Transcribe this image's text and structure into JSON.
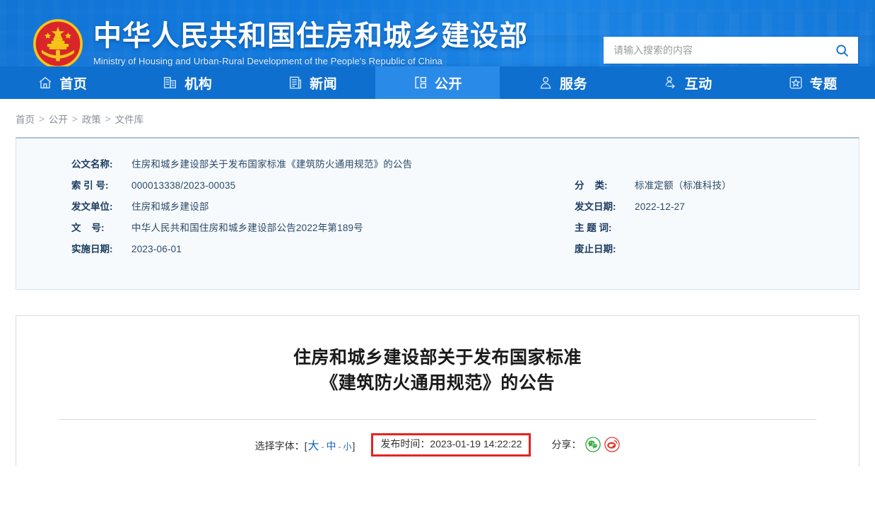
{
  "header": {
    "emblem_icon": "china-national-emblem",
    "site_url": "www.mohurd.gov.cn",
    "title_cn": "中华人民共和国住房和城乡建设部",
    "title_en": "Ministry of Housing and Urban-Rural Development of the People's Republic of China",
    "search": {
      "placeholder": "请输入搜索的内容",
      "value": "",
      "button_icon": "search-icon"
    },
    "brand_color": "#1275d6",
    "nav_active_color": "#2a8ae8"
  },
  "nav": {
    "items": [
      {
        "label": "首页",
        "icon": "home-icon",
        "active": false
      },
      {
        "label": "机构",
        "icon": "building-icon",
        "active": false
      },
      {
        "label": "新闻",
        "icon": "news-icon",
        "active": false
      },
      {
        "label": "公开",
        "icon": "open-folder-icon",
        "active": true
      },
      {
        "label": "服务",
        "icon": "person-service-icon",
        "active": false
      },
      {
        "label": "互动",
        "icon": "person-exchange-icon",
        "active": false
      },
      {
        "label": "专题",
        "icon": "star-box-icon",
        "active": false
      }
    ]
  },
  "breadcrumb": {
    "items": [
      "首页",
      "公开",
      "政策",
      "文件库"
    ],
    "separator": ">"
  },
  "info_panel": {
    "left_rows": [
      {
        "label": "公文名称:",
        "value": "住房和城乡建设部关于发布国家标准《建筑防火通用规范》的公告"
      },
      {
        "label": "索 引 号:",
        "value": "000013338/2023-00035"
      },
      {
        "label": "发文单位:",
        "value": "住房和城乡建设部"
      },
      {
        "label": "文    号:",
        "value": "中华人民共和国住房和城乡建设部公告2022年第189号"
      },
      {
        "label": "实施日期:",
        "value": "2023-06-01"
      }
    ],
    "right_rows": [
      {
        "label": "分    类:",
        "value": "标准定额（标准科技）"
      },
      {
        "label": "发文日期:",
        "value": "2022-12-27"
      },
      {
        "label": "主 题 词:",
        "value": ""
      },
      {
        "label": "废止日期:",
        "value": ""
      }
    ]
  },
  "article": {
    "title_line1": "住房和城乡建设部关于发布国家标准",
    "title_line2": "《建筑防火通用规范》的公告",
    "font_choose_label": "选择字体：[",
    "font_sizes": {
      "big": "大",
      "mid": "中",
      "small": "小"
    },
    "font_dash": "-",
    "font_choose_close": "]",
    "publish_time": "发布时间：2023-01-19 14:22:22",
    "publish_box_color": "#e8221f",
    "share_label": "分享：",
    "share_icons": [
      {
        "name": "wechat-share-icon",
        "color": "#2aab38"
      },
      {
        "name": "weibo-share-icon",
        "color": "#e23a32"
      }
    ]
  }
}
